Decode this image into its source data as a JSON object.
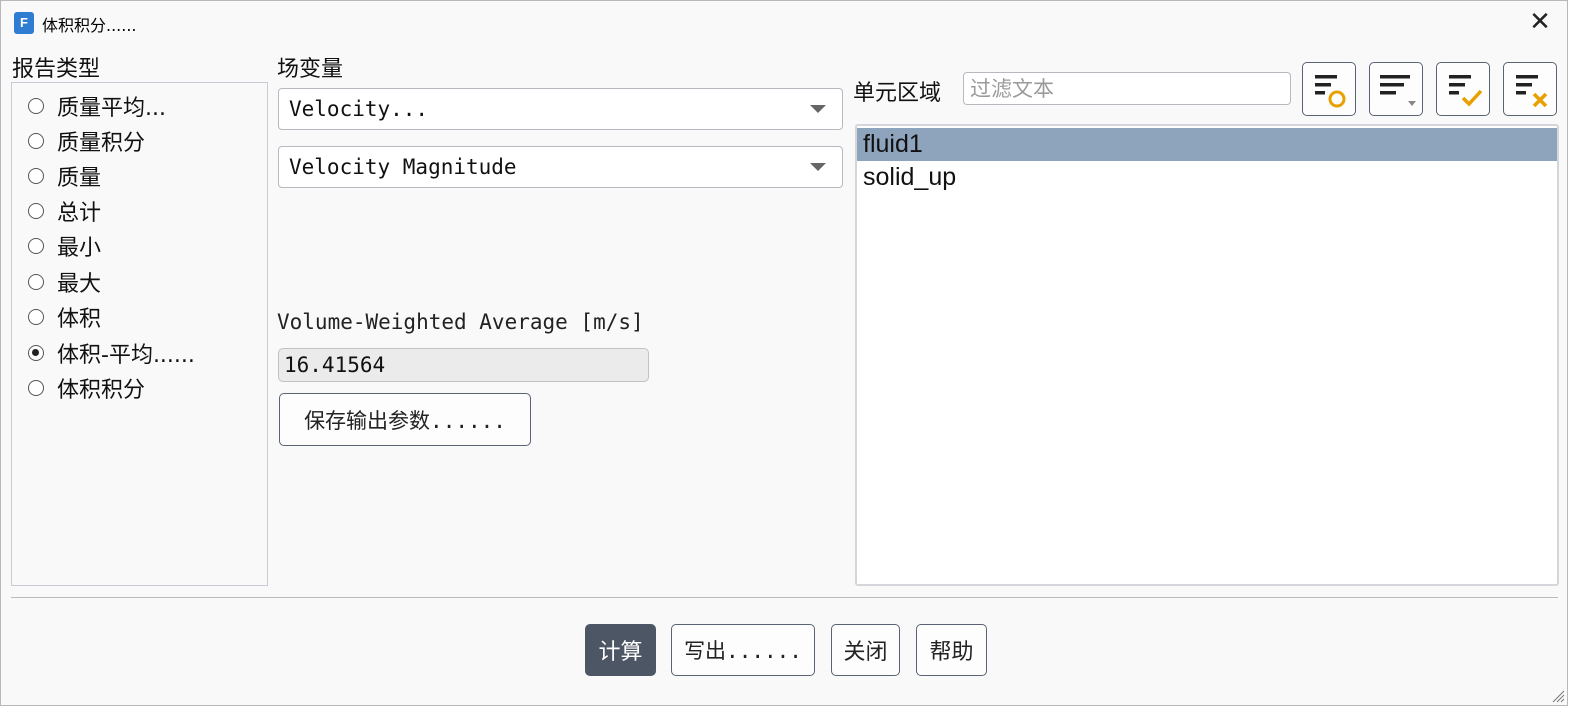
{
  "window": {
    "title": "体积积分......",
    "app_icon_letter": "F",
    "close_glyph": "✕"
  },
  "report_type": {
    "label": "报告类型",
    "options": [
      {
        "label": "质量平均...",
        "checked": false
      },
      {
        "label": "质量积分",
        "checked": false
      },
      {
        "label": "质量",
        "checked": false
      },
      {
        "label": "总计",
        "checked": false
      },
      {
        "label": "最小",
        "checked": false
      },
      {
        "label": "最大",
        "checked": false
      },
      {
        "label": "体积",
        "checked": false
      },
      {
        "label": "体积-平均......",
        "checked": true
      },
      {
        "label": "体积积分",
        "checked": false
      }
    ]
  },
  "field_variable": {
    "label": "场变量",
    "category": "Velocity...",
    "variable": "Velocity Magnitude"
  },
  "result": {
    "label": "Volume-Weighted Average [m/s]",
    "value": "16.41564",
    "save_button": "保存输出参数......"
  },
  "cell_zones": {
    "label": "单元区域",
    "filter_placeholder": "过滤文本",
    "filter_value": "",
    "tool_icons": [
      "select-matching-icon",
      "sort-filter-dropdown-icon",
      "select-all-icon",
      "deselect-all-icon"
    ],
    "items": [
      {
        "label": "fluid1",
        "selected": true
      },
      {
        "label": "solid_up",
        "selected": false
      }
    ]
  },
  "footer": {
    "compute": "计算",
    "write": "写出......",
    "close": "关闭",
    "help": "帮助"
  },
  "colors": {
    "accent_dark": "#4d5664",
    "selection": "#8ea4bc",
    "check_orange": "#e8a000"
  }
}
